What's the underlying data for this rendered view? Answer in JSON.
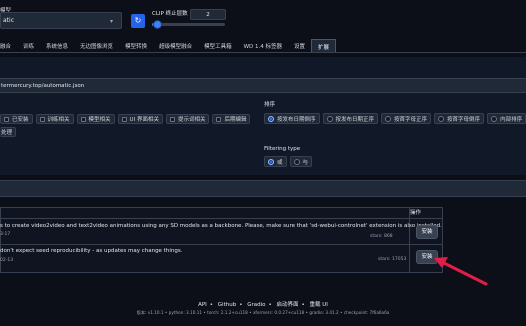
{
  "model": {
    "label": "模型",
    "selected": "atic",
    "refresh_icon": "refresh-icon"
  },
  "clip": {
    "label": "CLIP 终止层数",
    "value": "2"
  },
  "tabs": [
    {
      "label": "融合"
    },
    {
      "label": "训练"
    },
    {
      "label": "系统信息"
    },
    {
      "label": "无边图像浏览"
    },
    {
      "label": "模型转换"
    },
    {
      "label": "超级模型融合"
    },
    {
      "label": "模型工具箱"
    },
    {
      "label": "WD 1.4 标签器"
    },
    {
      "label": "设置"
    },
    {
      "label": "扩展"
    }
  ],
  "url": "termercury.top/automatic.json",
  "filters": {
    "row1": [
      "已安装",
      "训练相关",
      "模型相关",
      "UI 界面相关",
      "提示词相关",
      "后期编辑"
    ],
    "row2": [
      "处理"
    ]
  },
  "sort": {
    "label": "排序",
    "options": [
      "按发布日期倒序",
      "按发布日期正序",
      "按首字母正序",
      "按首字母倒序",
      "内部排序"
    ],
    "selected": 0
  },
  "filtering_type": {
    "label": "Filtering type",
    "options": [
      "或",
      "与"
    ],
    "selected": 0
  },
  "table": {
    "action_header": "操作",
    "rows": [
      {
        "description": "s to create video2video and text2video animations using any SD models as a backbone. Please, make sure that 'sd-webui-controlnet' extension is also installed.",
        "date": "3-17",
        "stars": "stars: 868",
        "button": "安装"
      },
      {
        "description": "don't expect seed reproducibility - as updates may change things.",
        "date": "02-13",
        "stars": "stars: 17053",
        "button": "安装"
      }
    ]
  },
  "footer": {
    "links": [
      "API",
      "Github",
      "Gradio",
      "启动界面",
      "重载 UI"
    ],
    "version": "版本: v1.10.1  •  python: 3.10.11  •  torch: 2.1.2+cu118  •  xformers: 0.0.27+cu118  •  gradio: 3.41.2  •  checkpoint: 7f6a6a6a"
  },
  "colors": {
    "accent": "#3b82f6",
    "annotation_arrow": "#e11d48"
  }
}
